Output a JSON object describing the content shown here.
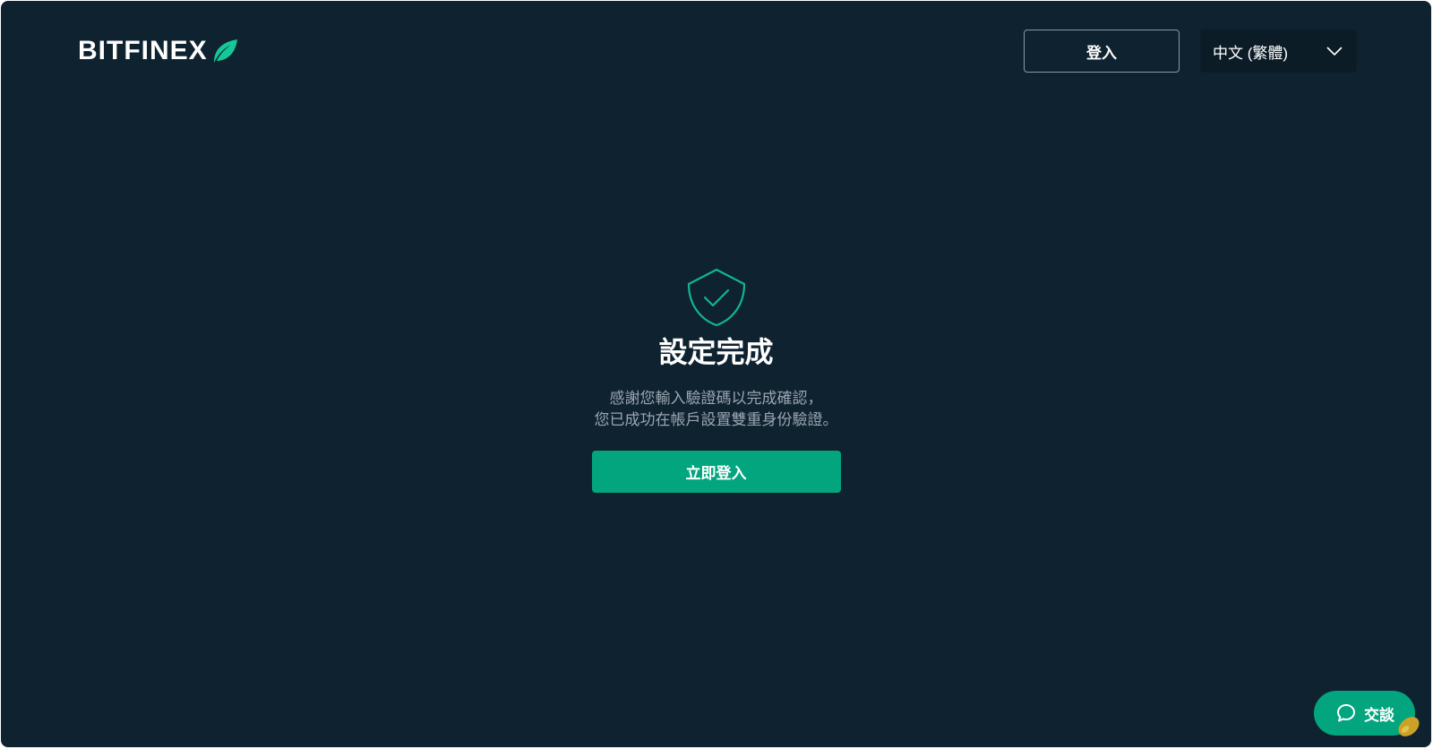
{
  "header": {
    "logo_text": "BITFINEX",
    "login_label": "登入",
    "language_selected": "中文 (繁體)"
  },
  "main": {
    "title": "設定完成",
    "message_line1": "感謝您輸入驗證碼以完成確認，",
    "message_line2": "您已成功在帳戶設置雙重身份驗證。",
    "cta_label": "立即登入"
  },
  "chat": {
    "label": "交談"
  },
  "icons": {
    "logo": "leaf-icon",
    "language": "chevron-down-icon",
    "status": "shield-check-icon",
    "chat": "chat-bubble-icon"
  },
  "colors": {
    "background": "#0f2230",
    "accent": "#03a57f",
    "shield_stroke": "#10b68c",
    "muted_text": "#9aa6b0"
  }
}
